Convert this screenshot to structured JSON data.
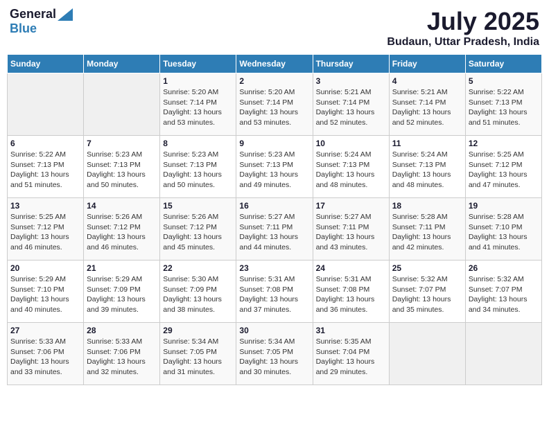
{
  "header": {
    "logo_general": "General",
    "logo_blue": "Blue",
    "month": "July 2025",
    "location": "Budaun, Uttar Pradesh, India"
  },
  "days_of_week": [
    "Sunday",
    "Monday",
    "Tuesday",
    "Wednesday",
    "Thursday",
    "Friday",
    "Saturday"
  ],
  "weeks": [
    [
      {
        "day": "",
        "sunrise": "",
        "sunset": "",
        "daylight": "",
        "empty": true
      },
      {
        "day": "",
        "sunrise": "",
        "sunset": "",
        "daylight": "",
        "empty": true
      },
      {
        "day": "1",
        "sunrise": "Sunrise: 5:20 AM",
        "sunset": "Sunset: 7:14 PM",
        "daylight": "Daylight: 13 hours and 53 minutes."
      },
      {
        "day": "2",
        "sunrise": "Sunrise: 5:20 AM",
        "sunset": "Sunset: 7:14 PM",
        "daylight": "Daylight: 13 hours and 53 minutes."
      },
      {
        "day": "3",
        "sunrise": "Sunrise: 5:21 AM",
        "sunset": "Sunset: 7:14 PM",
        "daylight": "Daylight: 13 hours and 52 minutes."
      },
      {
        "day": "4",
        "sunrise": "Sunrise: 5:21 AM",
        "sunset": "Sunset: 7:14 PM",
        "daylight": "Daylight: 13 hours and 52 minutes."
      },
      {
        "day": "5",
        "sunrise": "Sunrise: 5:22 AM",
        "sunset": "Sunset: 7:13 PM",
        "daylight": "Daylight: 13 hours and 51 minutes."
      }
    ],
    [
      {
        "day": "6",
        "sunrise": "Sunrise: 5:22 AM",
        "sunset": "Sunset: 7:13 PM",
        "daylight": "Daylight: 13 hours and 51 minutes."
      },
      {
        "day": "7",
        "sunrise": "Sunrise: 5:23 AM",
        "sunset": "Sunset: 7:13 PM",
        "daylight": "Daylight: 13 hours and 50 minutes."
      },
      {
        "day": "8",
        "sunrise": "Sunrise: 5:23 AM",
        "sunset": "Sunset: 7:13 PM",
        "daylight": "Daylight: 13 hours and 50 minutes."
      },
      {
        "day": "9",
        "sunrise": "Sunrise: 5:23 AM",
        "sunset": "Sunset: 7:13 PM",
        "daylight": "Daylight: 13 hours and 49 minutes."
      },
      {
        "day": "10",
        "sunrise": "Sunrise: 5:24 AM",
        "sunset": "Sunset: 7:13 PM",
        "daylight": "Daylight: 13 hours and 48 minutes."
      },
      {
        "day": "11",
        "sunrise": "Sunrise: 5:24 AM",
        "sunset": "Sunset: 7:13 PM",
        "daylight": "Daylight: 13 hours and 48 minutes."
      },
      {
        "day": "12",
        "sunrise": "Sunrise: 5:25 AM",
        "sunset": "Sunset: 7:12 PM",
        "daylight": "Daylight: 13 hours and 47 minutes."
      }
    ],
    [
      {
        "day": "13",
        "sunrise": "Sunrise: 5:25 AM",
        "sunset": "Sunset: 7:12 PM",
        "daylight": "Daylight: 13 hours and 46 minutes."
      },
      {
        "day": "14",
        "sunrise": "Sunrise: 5:26 AM",
        "sunset": "Sunset: 7:12 PM",
        "daylight": "Daylight: 13 hours and 46 minutes."
      },
      {
        "day": "15",
        "sunrise": "Sunrise: 5:26 AM",
        "sunset": "Sunset: 7:12 PM",
        "daylight": "Daylight: 13 hours and 45 minutes."
      },
      {
        "day": "16",
        "sunrise": "Sunrise: 5:27 AM",
        "sunset": "Sunset: 7:11 PM",
        "daylight": "Daylight: 13 hours and 44 minutes."
      },
      {
        "day": "17",
        "sunrise": "Sunrise: 5:27 AM",
        "sunset": "Sunset: 7:11 PM",
        "daylight": "Daylight: 13 hours and 43 minutes."
      },
      {
        "day": "18",
        "sunrise": "Sunrise: 5:28 AM",
        "sunset": "Sunset: 7:11 PM",
        "daylight": "Daylight: 13 hours and 42 minutes."
      },
      {
        "day": "19",
        "sunrise": "Sunrise: 5:28 AM",
        "sunset": "Sunset: 7:10 PM",
        "daylight": "Daylight: 13 hours and 41 minutes."
      }
    ],
    [
      {
        "day": "20",
        "sunrise": "Sunrise: 5:29 AM",
        "sunset": "Sunset: 7:10 PM",
        "daylight": "Daylight: 13 hours and 40 minutes."
      },
      {
        "day": "21",
        "sunrise": "Sunrise: 5:29 AM",
        "sunset": "Sunset: 7:09 PM",
        "daylight": "Daylight: 13 hours and 39 minutes."
      },
      {
        "day": "22",
        "sunrise": "Sunrise: 5:30 AM",
        "sunset": "Sunset: 7:09 PM",
        "daylight": "Daylight: 13 hours and 38 minutes."
      },
      {
        "day": "23",
        "sunrise": "Sunrise: 5:31 AM",
        "sunset": "Sunset: 7:08 PM",
        "daylight": "Daylight: 13 hours and 37 minutes."
      },
      {
        "day": "24",
        "sunrise": "Sunrise: 5:31 AM",
        "sunset": "Sunset: 7:08 PM",
        "daylight": "Daylight: 13 hours and 36 minutes."
      },
      {
        "day": "25",
        "sunrise": "Sunrise: 5:32 AM",
        "sunset": "Sunset: 7:07 PM",
        "daylight": "Daylight: 13 hours and 35 minutes."
      },
      {
        "day": "26",
        "sunrise": "Sunrise: 5:32 AM",
        "sunset": "Sunset: 7:07 PM",
        "daylight": "Daylight: 13 hours and 34 minutes."
      }
    ],
    [
      {
        "day": "27",
        "sunrise": "Sunrise: 5:33 AM",
        "sunset": "Sunset: 7:06 PM",
        "daylight": "Daylight: 13 hours and 33 minutes."
      },
      {
        "day": "28",
        "sunrise": "Sunrise: 5:33 AM",
        "sunset": "Sunset: 7:06 PM",
        "daylight": "Daylight: 13 hours and 32 minutes."
      },
      {
        "day": "29",
        "sunrise": "Sunrise: 5:34 AM",
        "sunset": "Sunset: 7:05 PM",
        "daylight": "Daylight: 13 hours and 31 minutes."
      },
      {
        "day": "30",
        "sunrise": "Sunrise: 5:34 AM",
        "sunset": "Sunset: 7:05 PM",
        "daylight": "Daylight: 13 hours and 30 minutes."
      },
      {
        "day": "31",
        "sunrise": "Sunrise: 5:35 AM",
        "sunset": "Sunset: 7:04 PM",
        "daylight": "Daylight: 13 hours and 29 minutes."
      },
      {
        "day": "",
        "sunrise": "",
        "sunset": "",
        "daylight": "",
        "empty": true
      },
      {
        "day": "",
        "sunrise": "",
        "sunset": "",
        "daylight": "",
        "empty": true
      }
    ]
  ]
}
